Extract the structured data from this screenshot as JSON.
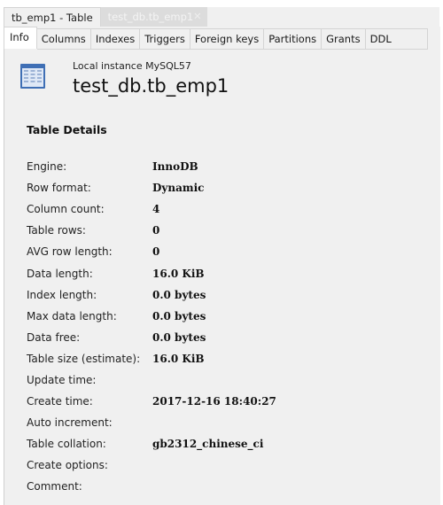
{
  "document_tabs": [
    {
      "label": "tb_emp1 - Table",
      "active": true
    },
    {
      "label": "test_db.tb_emp1",
      "active": false,
      "close_icon": "close-icon"
    }
  ],
  "tabs": [
    {
      "label": "Info",
      "active": true
    },
    {
      "label": "Columns"
    },
    {
      "label": "Indexes"
    },
    {
      "label": "Triggers"
    },
    {
      "label": "Foreign keys"
    },
    {
      "label": "Partitions"
    },
    {
      "label": "Grants"
    },
    {
      "label": "DDL"
    }
  ],
  "header": {
    "icon": "table-icon",
    "instance": "Local instance MySQL57",
    "title": "test_db.tb_emp1"
  },
  "section_title": "Table Details",
  "details": [
    {
      "label": "Engine:",
      "value": "InnoDB"
    },
    {
      "label": "Row format:",
      "value": "Dynamic"
    },
    {
      "label": "Column count:",
      "value": "4"
    },
    {
      "label": "Table rows:",
      "value": "0"
    },
    {
      "label": "AVG row length:",
      "value": "0"
    },
    {
      "label": "Data length:",
      "value": "16.0 KiB"
    },
    {
      "label": "Index length:",
      "value": "0.0 bytes"
    },
    {
      "label": "Max data length:",
      "value": "0.0 bytes"
    },
    {
      "label": "Data free:",
      "value": "0.0 bytes"
    },
    {
      "label": "Table size (estimate):",
      "value": "16.0 KiB"
    },
    {
      "label": "Update time:",
      "value": ""
    },
    {
      "label": "Create time:",
      "value": "2017-12-16 18:40:27"
    },
    {
      "label": "Auto increment:",
      "value": ""
    },
    {
      "label": "Table collation:",
      "value": "gb2312_chinese_ci"
    },
    {
      "label": "Create options:",
      "value": ""
    },
    {
      "label": "Comment:",
      "value": ""
    }
  ]
}
